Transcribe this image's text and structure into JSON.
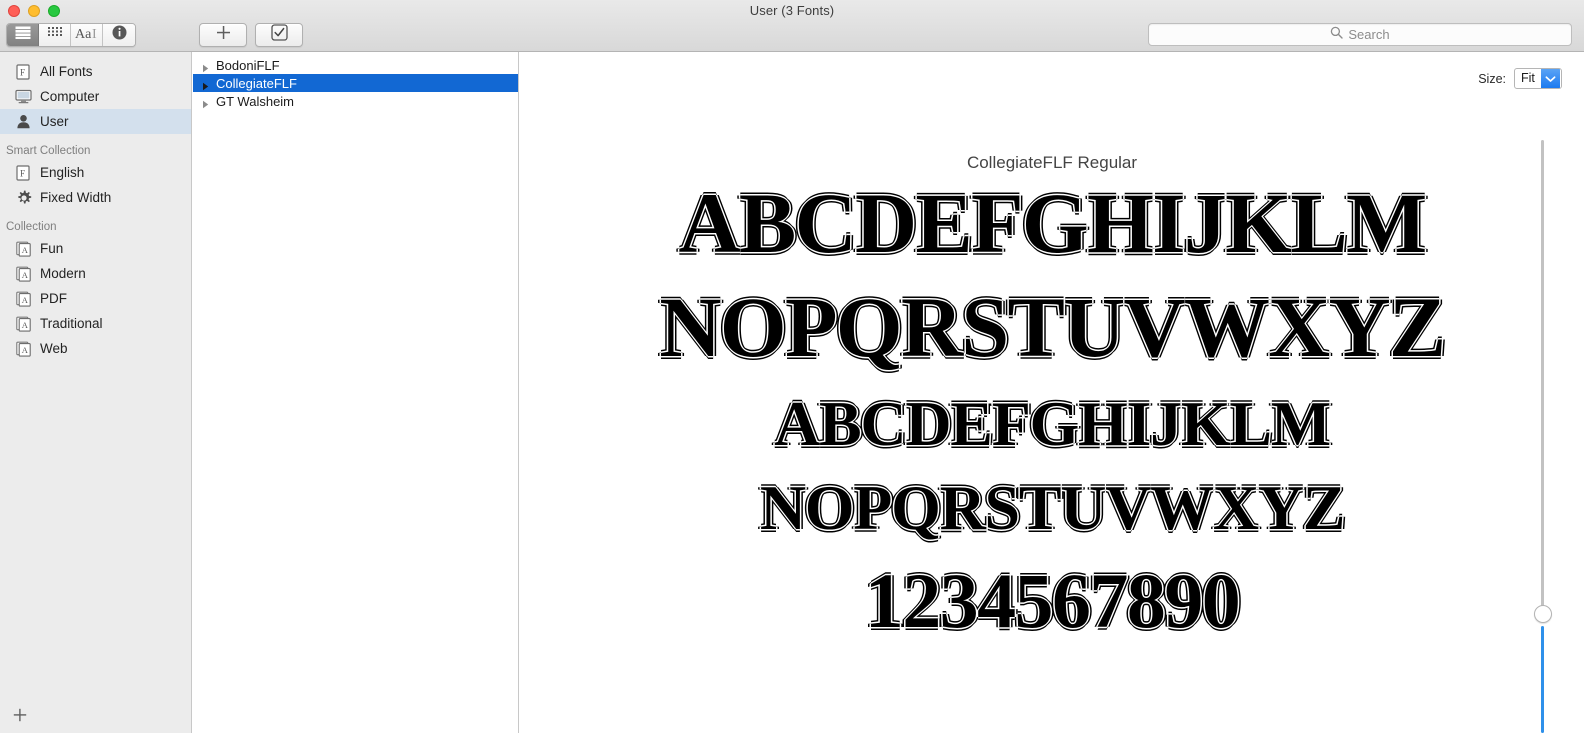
{
  "window": {
    "title": "User (3 Fonts)",
    "traffic_lights": [
      {
        "name": "close",
        "color": "#ff5f57"
      },
      {
        "name": "minimize",
        "color": "#ffbd2e"
      },
      {
        "name": "maximize",
        "color": "#28c840"
      }
    ]
  },
  "toolbar": {
    "view_segments": [
      {
        "icon": "list-view-icon",
        "selected": true
      },
      {
        "icon": "grid-view-icon",
        "selected": false
      },
      {
        "icon": "sample-text-icon",
        "selected": false
      },
      {
        "icon": "info-icon",
        "selected": false
      }
    ],
    "add_button_icon": "plus-icon",
    "validate_button_icon": "checkbox-icon",
    "search": {
      "icon": "search-icon",
      "value": "",
      "placeholder": "Search"
    }
  },
  "sidebar": {
    "top_items": [
      {
        "label": "All Fonts",
        "icon": "font-file-icon",
        "selected": false
      },
      {
        "label": "Computer",
        "icon": "computer-icon",
        "selected": false
      },
      {
        "label": "User",
        "icon": "user-icon",
        "selected": true
      }
    ],
    "smart_collection_header": "Smart Collection",
    "smart_items": [
      {
        "label": "English",
        "icon": "font-file-icon",
        "selected": false
      },
      {
        "label": "Fixed Width",
        "icon": "gear-icon",
        "selected": false
      }
    ],
    "collection_header": "Collection",
    "collection_items": [
      {
        "label": "Fun",
        "icon": "collection-icon",
        "selected": false
      },
      {
        "label": "Modern",
        "icon": "collection-icon",
        "selected": false
      },
      {
        "label": "PDF",
        "icon": "collection-icon",
        "selected": false
      },
      {
        "label": "Traditional",
        "icon": "collection-icon",
        "selected": false
      },
      {
        "label": "Web",
        "icon": "collection-icon",
        "selected": false
      }
    ],
    "add_collection_icon": "plus-icon",
    "selection_color": "#d3e0ed"
  },
  "font_list": {
    "rows": [
      {
        "name": "BodoniFLF",
        "selected": false,
        "expanded": false
      },
      {
        "name": "CollegiateFLF",
        "selected": true,
        "expanded": false
      },
      {
        "name": "GT Walsheim",
        "selected": false,
        "expanded": false
      }
    ],
    "selection_color": "#1268d3"
  },
  "preview": {
    "size_label": "Size:",
    "size_value": "Fit",
    "size_arrow_icon": "chevron-down-icon",
    "font_title": "CollegiateFLF Regular",
    "specimen_lines": [
      "ABCDEFGHIJKLM",
      "NOPQRSTUVWXYZ",
      "ABCDEFGHIJKLM",
      "NOPQRSTUVWXYZ",
      "1234567890"
    ],
    "slider": {
      "name": "size-slider",
      "filled_color": "#2e90ea",
      "track_color": "#c2c2c2"
    }
  }
}
